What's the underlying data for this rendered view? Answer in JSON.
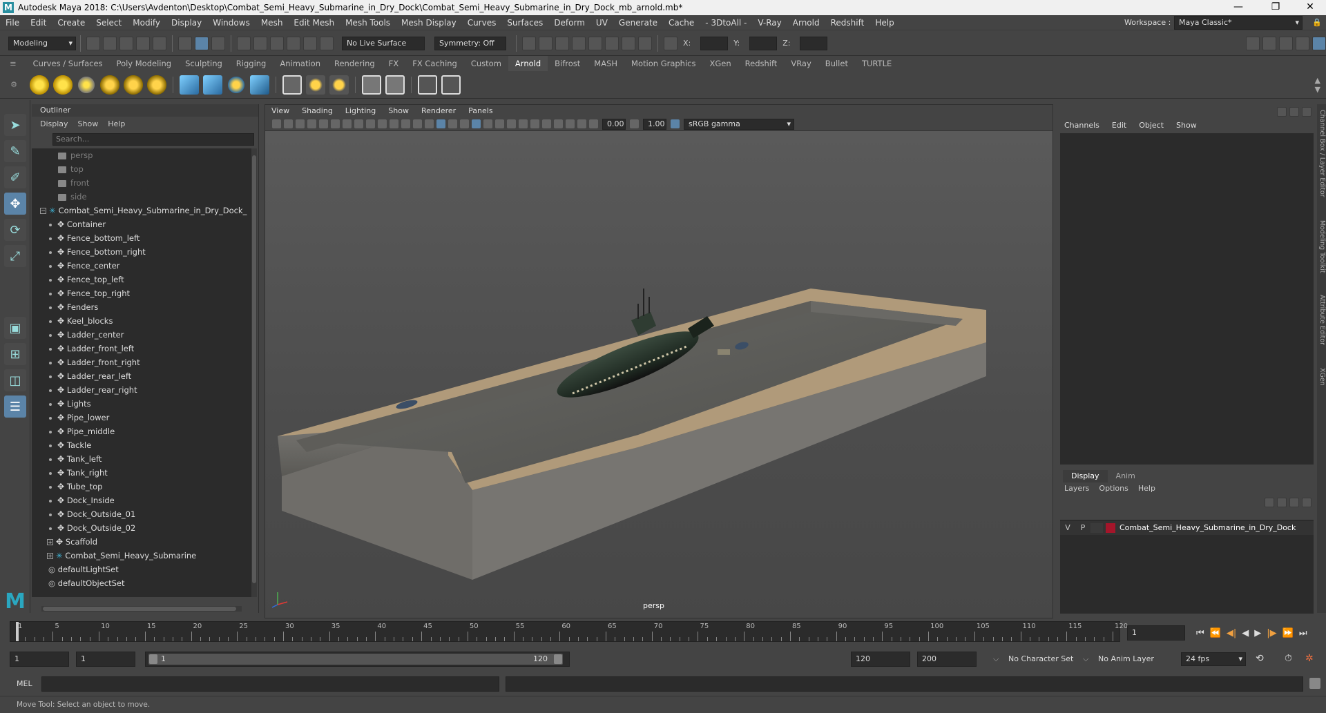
{
  "window": {
    "title": "Autodesk Maya 2018: C:\\Users\\Avdenton\\Desktop\\Combat_Semi_Heavy_Submarine_in_Dry_Dock\\Combat_Semi_Heavy_Submarine_in_Dry_Dock_mb_arnold.mb*"
  },
  "menubar": {
    "items": [
      "File",
      "Edit",
      "Create",
      "Select",
      "Modify",
      "Display",
      "Windows",
      "Mesh",
      "Edit Mesh",
      "Mesh Tools",
      "Mesh Display",
      "Curves",
      "Surfaces",
      "Deform",
      "UV",
      "Generate",
      "Cache",
      "- 3DtoAll -",
      "V-Ray",
      "Arnold",
      "Redshift",
      "Help"
    ],
    "workspace_label": "Workspace :",
    "workspace_value": "Maya Classic*"
  },
  "statusline": {
    "mode": "Modeling",
    "live_surface": "No Live Surface",
    "symmetry": "Symmetry: Off",
    "x_label": "X:",
    "y_label": "Y:",
    "z_label": "Z:"
  },
  "shelf": {
    "tabs": [
      "Curves / Surfaces",
      "Poly Modeling",
      "Sculpting",
      "Rigging",
      "Animation",
      "Rendering",
      "FX",
      "FX Caching",
      "Custom",
      "Arnold",
      "Bifrost",
      "MASH",
      "Motion Graphics",
      "XGen",
      "Redshift",
      "VRay",
      "Bullet",
      "TURTLE"
    ],
    "active": "Arnold"
  },
  "outliner": {
    "title": "Outliner",
    "menu": [
      "Display",
      "Show",
      "Help"
    ],
    "search_placeholder": "Search...",
    "cameras": [
      "persp",
      "top",
      "front",
      "side"
    ],
    "root": "Combat_Semi_Heavy_Submarine_in_Dry_Dock_",
    "children": [
      "Container",
      "Fence_bottom_left",
      "Fence_bottom_right",
      "Fence_center",
      "Fence_top_left",
      "Fence_top_right",
      "Fenders",
      "Keel_blocks",
      "Ladder_center",
      "Ladder_front_left",
      "Ladder_front_right",
      "Ladder_rear_left",
      "Ladder_rear_right",
      "Lights",
      "Pipe_lower",
      "Pipe_middle",
      "Tackle",
      "Tank_left",
      "Tank_right",
      "Tube_top",
      "Dock_Inside",
      "Dock_Outside_01",
      "Dock_Outside_02"
    ],
    "groups": [
      "Scaffold",
      "Combat_Semi_Heavy_Submarine"
    ],
    "sets": [
      "defaultLightSet",
      "defaultObjectSet"
    ]
  },
  "viewport": {
    "menu": [
      "View",
      "Shading",
      "Lighting",
      "Show",
      "Renderer",
      "Panels"
    ],
    "exposure": "0.00",
    "gamma": "1.00",
    "color_space": "sRGB gamma",
    "camera_label": "persp"
  },
  "channelbox": {
    "menu": [
      "Channels",
      "Edit",
      "Object",
      "Show"
    ]
  },
  "layers": {
    "tabs": [
      "Display",
      "Anim"
    ],
    "active_tab": "Display",
    "menu": [
      "Layers",
      "Options",
      "Help"
    ],
    "row": {
      "v": "V",
      "p": "P",
      "name": "Combat_Semi_Heavy_Submarine_in_Dry_Dock",
      "color": "#a4152a"
    }
  },
  "sidetabs": [
    "Channel Box / Layer Editor",
    "Modeling Toolkit",
    "Attribute Editor",
    "XGen"
  ],
  "timeline": {
    "ticks": [
      "1",
      "5",
      "10",
      "15",
      "20",
      "25",
      "30",
      "35",
      "40",
      "45",
      "50",
      "55",
      "60",
      "65",
      "70",
      "75",
      "80",
      "85",
      "90",
      "95",
      "100",
      "105",
      "110",
      "115",
      "120"
    ],
    "current_frame": "1"
  },
  "range": {
    "start": "1",
    "playback_start": "1",
    "slider_start": "1",
    "slider_end": "120",
    "playback_end": "120",
    "end": "200",
    "character_set": "No Character Set",
    "anim_layer": "No Anim Layer",
    "fps": "24 fps"
  },
  "cmdline": {
    "label": "MEL"
  },
  "helpline": {
    "text": "Move Tool: Select an object to move."
  }
}
